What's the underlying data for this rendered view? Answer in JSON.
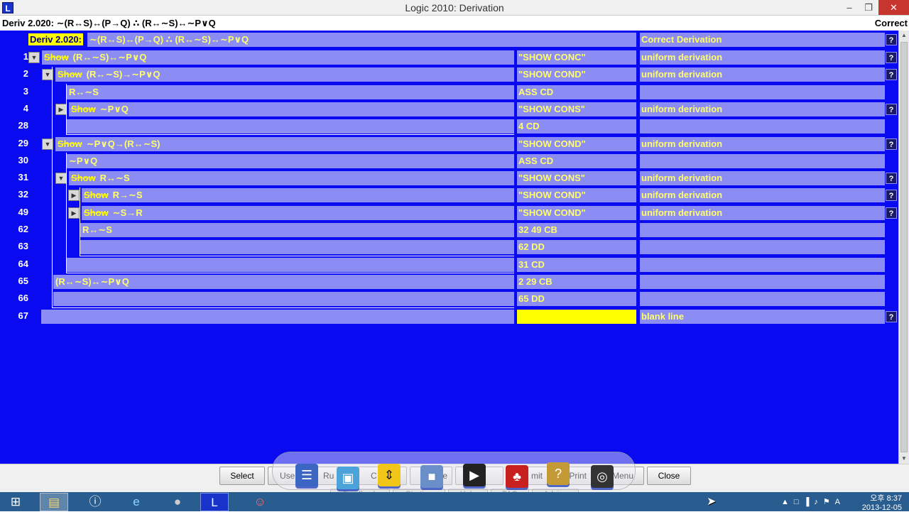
{
  "window": {
    "title": "Logic 2010: Derivation",
    "app_icon": "L",
    "header_left": "Deriv 2.020:  ∼(R↔S)↔(P→Q) ∴ (R↔∼S)↔∼P∨Q",
    "header_right": "Correct"
  },
  "derivation": {
    "label": "Deriv 2.020:",
    "formula": "∼(R↔S)↔(P→Q) ∴ (R↔∼S)↔∼P∨Q",
    "status": "Correct Derivation",
    "help": "?",
    "rows": [
      {
        "num": "1",
        "show": "Show",
        "text": "(R↔∼S)↔∼P∨Q",
        "just": "\"SHOW CONC\"",
        "status": "uniform derivation",
        "help": "?"
      },
      {
        "num": "2",
        "show": "Show",
        "text": "(R↔∼S)→∼P∨Q",
        "just": "\"SHOW COND\"",
        "status": "uniform derivation",
        "help": "?"
      },
      {
        "num": "3",
        "show": "",
        "text": "R↔∼S",
        "just": "ASS CD",
        "status": "",
        "help": ""
      },
      {
        "num": "4",
        "show": "Show",
        "text": "∼P∨Q",
        "just": "\"SHOW CONS\"",
        "status": "uniform derivation",
        "help": "?"
      },
      {
        "num": "28",
        "show": "",
        "text": "",
        "just": "4 CD",
        "status": "",
        "help": ""
      },
      {
        "num": "29",
        "show": "Show",
        "text": "∼P∨Q→(R↔∼S)",
        "just": "\"SHOW COND\"",
        "status": "uniform derivation",
        "help": "?"
      },
      {
        "num": "30",
        "show": "",
        "text": "∼P∨Q",
        "just": "ASS CD",
        "status": "",
        "help": ""
      },
      {
        "num": "31",
        "show": "Show",
        "text": "R↔∼S",
        "just": "\"SHOW CONS\"",
        "status": "uniform derivation",
        "help": "?"
      },
      {
        "num": "32",
        "show": "Show",
        "text": "R→∼S",
        "just": "\"SHOW COND\"",
        "status": "uniform derivation",
        "help": "?"
      },
      {
        "num": "49",
        "show": "Show",
        "text": "∼S→R",
        "just": "\"SHOW COND\"",
        "status": "uniform derivation",
        "help": "?"
      },
      {
        "num": "62",
        "show": "",
        "text": "R↔∼S",
        "just": "32 49 CB",
        "status": "",
        "help": ""
      },
      {
        "num": "63",
        "show": "",
        "text": "",
        "just": "62 DD",
        "status": "",
        "help": ""
      },
      {
        "num": "64",
        "show": "",
        "text": "",
        "just": "31 CD",
        "status": "",
        "help": ""
      },
      {
        "num": "65",
        "show": "",
        "text": "(R↔∼S)↔∼P∨Q",
        "just": "2 29 CB",
        "status": "",
        "help": ""
      },
      {
        "num": "66",
        "show": "",
        "text": "",
        "just": "65 DD",
        "status": "",
        "help": ""
      },
      {
        "num": "67",
        "show": "",
        "text": "",
        "just": "",
        "status": "blank line",
        "help": "?"
      }
    ]
  },
  "bottom_buttons": {
    "select": "Select",
    "use": "Use",
    "rules": "Ru",
    "c": "C",
    "e": "e",
    "submit": "mit",
    "print": "Print",
    "menu": "Menu",
    "close": "Close"
  },
  "bottom_ghost_buttons": {
    "feedback": "Feedback",
    "starting": "Starting",
    "help": "Help",
    "faq": "FAQ",
    "advice": "Advice"
  },
  "taskbar": {
    "clock_time": "오후 8:37",
    "clock_date": "2013-12-05"
  },
  "colors": {
    "workspace_bg": "#0a0af0",
    "cell_bg": "#8c8cf5",
    "cell_text": "#ffff66",
    "highlight": "#ffff00"
  }
}
